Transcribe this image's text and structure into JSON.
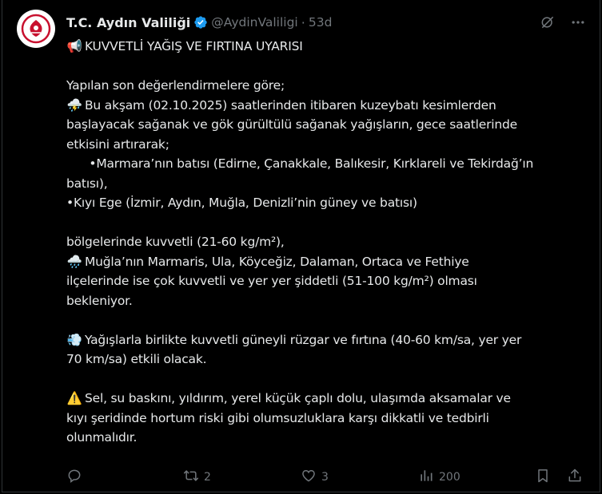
{
  "author": {
    "name": "T.C. Aydın Valiliği",
    "handle": "@AydinValiligi",
    "separator": "·",
    "time": "53d",
    "verified_color": "#1d9bf0"
  },
  "post": {
    "lines": [
      {
        "emoji": "📢",
        "text": "KUVVETLİ YAĞIŞ VE FIRTINA UYARISI"
      },
      {
        "emoji": "",
        "text": ""
      },
      {
        "emoji": "",
        "text": "Yapılan son değerlendirmelere göre;"
      },
      {
        "emoji": "⛈️",
        "text": "Bu akşam (02.10.2025) saatlerinden itibaren kuzeybatı kesimlerden"
      },
      {
        "emoji": "",
        "text": "başlayacak sağanak ve gök gürültülü sağanak yağışların, gece saatlerinde"
      },
      {
        "emoji": "",
        "text": "etkisini artırarak;"
      },
      {
        "emoji": "",
        "text": "      •Marmara’nın batısı (Edirne, Çanakkale, Balıkesir, Kırklareli ve Tekirdağ’ın"
      },
      {
        "emoji": "",
        "text": "batısı),"
      },
      {
        "emoji": "",
        "text": "•Kıyı Ege (İzmir, Aydın, Muğla, Denizli’nin güney ve batısı)"
      },
      {
        "emoji": "",
        "text": ""
      },
      {
        "emoji": "",
        "text": "bölgelerinde kuvvetli (21-60 kg/m²),"
      },
      {
        "emoji": "🌧️",
        "text": "Muğla’nın Marmaris, Ula, Köyceğiz, Dalaman, Ortaca ve Fethiye"
      },
      {
        "emoji": "",
        "text": "ilçelerinde ise çok kuvvetli ve yer yer şiddetli (51-100 kg/m²) olması"
      },
      {
        "emoji": "",
        "text": "bekleniyor."
      },
      {
        "emoji": "",
        "text": ""
      },
      {
        "emoji": "💨",
        "text": "Yağışlarla birlikte kuvvetli güneyli rüzgar ve fırtına (40-60 km/sa, yer yer"
      },
      {
        "emoji": "",
        "text": "70 km/sa) etkili olacak."
      },
      {
        "emoji": "",
        "text": ""
      },
      {
        "emoji": "⚠️",
        "text": "Sel, su baskını, yıldırım, yerel küçük çaplı dolu, ulaşımda aksamalar ve"
      },
      {
        "emoji": "",
        "text": "kıyı şeridinde hortum riski gibi olumsuzluklara karşı dikkatli ve tedbirli"
      },
      {
        "emoji": "",
        "text": "olunmalıdır."
      }
    ]
  },
  "actions": {
    "reply_count": "",
    "repost_count": "2",
    "like_count": "3",
    "views_count": "200"
  },
  "icons": {
    "grok": "grok-icon",
    "more": "more-icon",
    "reply": "reply-icon",
    "repost": "repost-icon",
    "like": "heart-icon",
    "views": "views-icon",
    "bookmark": "bookmark-icon",
    "share": "share-icon"
  }
}
